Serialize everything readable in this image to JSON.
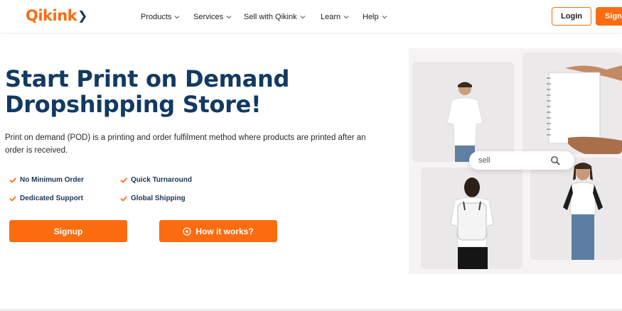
{
  "brand": {
    "name": "Qikink",
    "accent": "#fb6c10",
    "navy": "#123a62"
  },
  "nav": {
    "items": [
      {
        "label": "Products"
      },
      {
        "label": "Services"
      },
      {
        "label": "Sell with Qikink"
      },
      {
        "label": "Learn"
      },
      {
        "label": "Help"
      }
    ],
    "login_label": "Login",
    "signup_label": "Signup"
  },
  "hero": {
    "title_line1": "Start Print on Demand",
    "title_line2": "Dropshipping Store!",
    "description": "Print on demand (POD) is a printing and order fulfilment method where products are printed after an order is received.",
    "features": [
      "No Minimum Order",
      "Quick Turnaround",
      "Dedicated Support",
      "Global Shipping"
    ],
    "signup_label": "Signup",
    "how_label": "How it works?"
  },
  "collage": {
    "search_value": "sell",
    "search_icon": "search-icon"
  }
}
